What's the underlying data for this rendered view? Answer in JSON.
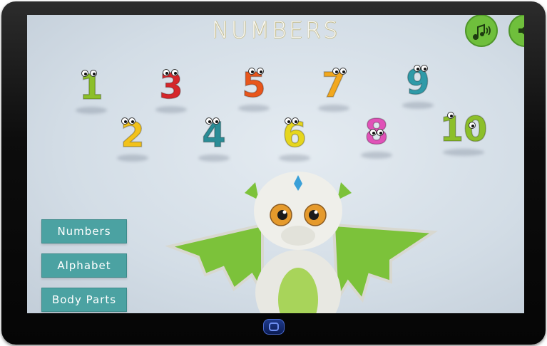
{
  "screen": {
    "title": "NUMBERS"
  },
  "controls": {
    "music_icon": "music-note",
    "sound_icon": "speaker",
    "accent": "#6fbf3c"
  },
  "numbers": [
    {
      "label": "1",
      "color": "#8cbf2a"
    },
    {
      "label": "2",
      "color": "#f2c21a"
    },
    {
      "label": "3",
      "color": "#d6262a"
    },
    {
      "label": "4",
      "color": "#2a8c96"
    },
    {
      "label": "5",
      "color": "#e8561c"
    },
    {
      "label": "6",
      "color": "#e6d61e"
    },
    {
      "label": "7",
      "color": "#f2a81e"
    },
    {
      "label": "8",
      "color": "#e052b8"
    },
    {
      "label": "9",
      "color": "#2f9aa8"
    },
    {
      "label": "10",
      "color": "#8cbf2a"
    }
  ],
  "menu": {
    "items": [
      "Numbers",
      "Alphabet",
      "Body Parts"
    ],
    "color": "#4ba2a2"
  }
}
